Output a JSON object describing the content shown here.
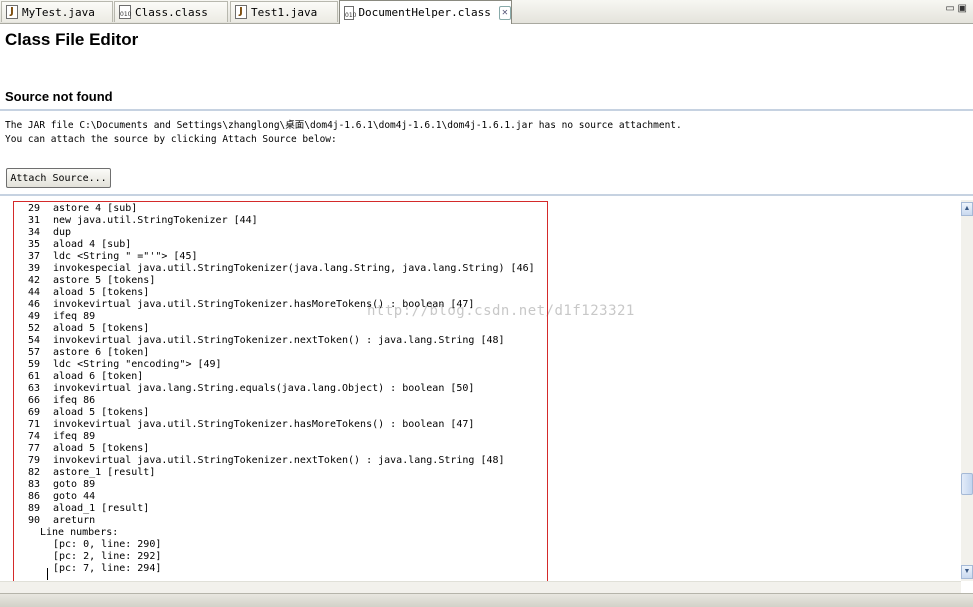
{
  "tabs": [
    {
      "label": "MyTest.java",
      "icon": "java-file-icon"
    },
    {
      "label": "Class.class",
      "icon": "class-file-icon"
    },
    {
      "label": "Test1.java",
      "icon": "java-file-icon"
    },
    {
      "label": "DocumentHelper.class",
      "icon": "class-file-icon",
      "active": true
    }
  ],
  "window_controls": {
    "minimize": "▭",
    "maximize": "▣"
  },
  "editor": {
    "title": "Class File Editor",
    "source_not_found": "Source not found",
    "jar_message": "The JAR file C:\\Documents and Settings\\zhanglong\\桌面\\dom4j-1.6.1\\dom4j-1.6.1\\dom4j-1.6.1.jar has no source attachment.",
    "attach_hint": "You can attach the source by clicking Attach Source below:",
    "attach_button": "Attach Source..."
  },
  "watermark": "http://blog.csdn.net/d1f123321",
  "bytecode": [
    {
      "n": "29",
      "op": "astore 4 [sub]"
    },
    {
      "n": "31",
      "op": "new java.util.StringTokenizer [44]"
    },
    {
      "n": "34",
      "op": "dup"
    },
    {
      "n": "35",
      "op": "aload 4 [sub]"
    },
    {
      "n": "37",
      "op": "ldc <String \" =\"'\"> [45]"
    },
    {
      "n": "39",
      "op": "invokespecial java.util.StringTokenizer(java.lang.String, java.lang.String) [46]"
    },
    {
      "n": "42",
      "op": "astore 5 [tokens]"
    },
    {
      "n": "44",
      "op": "aload 5 [tokens]"
    },
    {
      "n": "46",
      "op": "invokevirtual java.util.StringTokenizer.hasMoreTokens() : boolean [47]"
    },
    {
      "n": "49",
      "op": "ifeq 89"
    },
    {
      "n": "52",
      "op": "aload 5 [tokens]"
    },
    {
      "n": "54",
      "op": "invokevirtual java.util.StringTokenizer.nextToken() : java.lang.String [48]"
    },
    {
      "n": "57",
      "op": "astore 6 [token]"
    },
    {
      "n": "59",
      "op": "ldc <String \"encoding\"> [49]"
    },
    {
      "n": "61",
      "op": "aload 6 [token]"
    },
    {
      "n": "63",
      "op": "invokevirtual java.lang.String.equals(java.lang.Object) : boolean [50]"
    },
    {
      "n": "66",
      "op": "ifeq 86"
    },
    {
      "n": "69",
      "op": "aload 5 [tokens]"
    },
    {
      "n": "71",
      "op": "invokevirtual java.util.StringTokenizer.hasMoreTokens() : boolean [47]"
    },
    {
      "n": "74",
      "op": "ifeq 89"
    },
    {
      "n": "77",
      "op": "aload 5 [tokens]"
    },
    {
      "n": "79",
      "op": "invokevirtual java.util.StringTokenizer.nextToken() : java.lang.String [48]"
    },
    {
      "n": "82",
      "op": "astore_1 [result]"
    },
    {
      "n": "83",
      "op": "goto 89"
    },
    {
      "n": "86",
      "op": "goto 44"
    },
    {
      "n": "89",
      "op": "aload_1 [result]"
    },
    {
      "n": "90",
      "op": "areturn"
    }
  ],
  "line_numbers_label": "Line numbers:",
  "line_numbers": [
    "[pc: 0, line: 290]",
    "[pc: 2, line: 292]",
    "[pc: 7, line: 294]"
  ]
}
